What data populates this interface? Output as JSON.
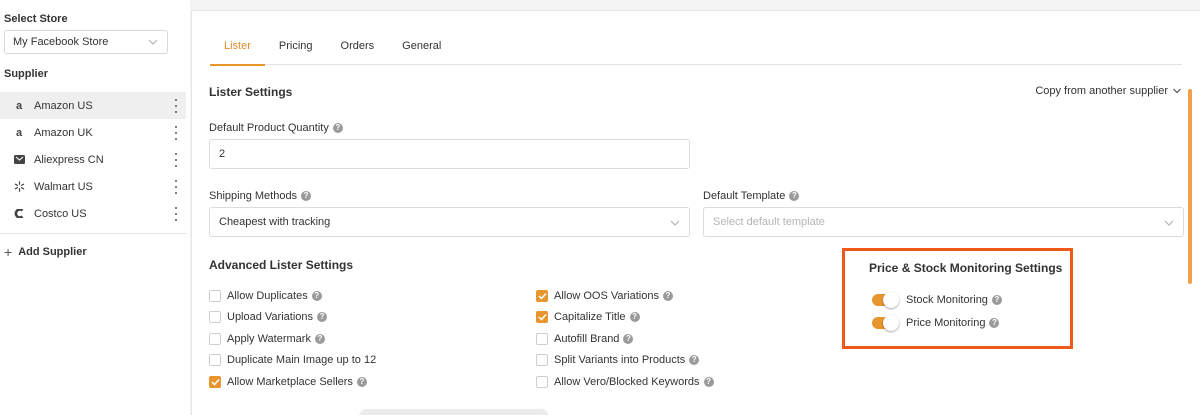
{
  "sidebar": {
    "store_label": "Select Store",
    "store_value": "My Facebook Store",
    "supplier_label": "Supplier",
    "suppliers": [
      {
        "name": "Amazon US",
        "icon": "amazon-icon"
      },
      {
        "name": "Amazon UK",
        "icon": "amazon-icon"
      },
      {
        "name": "Aliexpress CN",
        "icon": "aliexpress-icon"
      },
      {
        "name": "Walmart US",
        "icon": "walmart-icon"
      },
      {
        "name": "Costco US",
        "icon": "costco-icon"
      }
    ],
    "add_supplier": "Add Supplier"
  },
  "tabs": [
    {
      "label": "Lister",
      "active": true
    },
    {
      "label": "Pricing",
      "active": false
    },
    {
      "label": "Orders",
      "active": false
    },
    {
      "label": "General",
      "active": false
    }
  ],
  "lister": {
    "title": "Lister Settings",
    "copy_link": "Copy from another supplier",
    "quantity_label": "Default Product Quantity",
    "quantity_value": "2",
    "shipping_label": "Shipping Methods",
    "shipping_value": "Cheapest with tracking",
    "template_label": "Default Template",
    "template_placeholder": "Select default template"
  },
  "advanced": {
    "title": "Advanced Lister Settings",
    "left": [
      {
        "label": "Allow Duplicates",
        "checked": false
      },
      {
        "label": "Upload Variations",
        "checked": false
      },
      {
        "label": "Apply Watermark",
        "checked": false
      },
      {
        "label": "Duplicate Main Image up to 12",
        "checked": false
      },
      {
        "label": "Allow Marketplace Sellers",
        "checked": true
      }
    ],
    "right": [
      {
        "label": "Allow OOS Variations",
        "checked": true
      },
      {
        "label": "Capitalize Title",
        "checked": true
      },
      {
        "label": "Autofill Brand",
        "checked": false
      },
      {
        "label": "Split Variants into Products",
        "checked": false
      },
      {
        "label": "Allow Vero/Blocked Keywords",
        "checked": false
      }
    ]
  },
  "monitoring": {
    "title": "Price & Stock Monitoring Settings",
    "stock_label": "Stock Monitoring",
    "stock_on": true,
    "price_label": "Price Monitoring",
    "price_on": true
  },
  "colors": {
    "accent": "#e8952d",
    "highlight_border": "#ef5a1a"
  }
}
